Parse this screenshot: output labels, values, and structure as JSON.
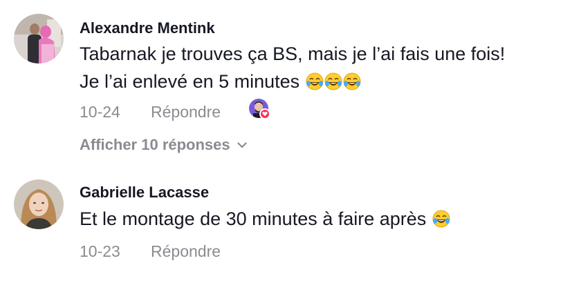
{
  "comments": [
    {
      "author": "Alexandre Mentink",
      "text_lines": [
        "Tabarnak je trouves ça BS, mais je l’ai fais une fois!",
        "Je l’ai enlevé en 5 minutes"
      ],
      "emoji_count": 3,
      "emoji_icon": "laughing-tears-emoji",
      "date": "10-24",
      "reply_label": "Répondre",
      "liked_by_creator": true,
      "view_replies_label": "Afficher 10 réponses",
      "avatar_icon": "avatar-photo"
    },
    {
      "author": "Gabrielle Lacasse",
      "text_lines": [
        "Et le montage de 30 minutes à faire après"
      ],
      "emoji_count": 1,
      "emoji_icon": "laughing-tears-emoji",
      "date": "10-23",
      "reply_label": "Répondre",
      "avatar_icon": "avatar-photo"
    }
  ],
  "colors": {
    "text": "#161823",
    "secondary": "#8a8b91",
    "heart": "#fe2c55"
  }
}
